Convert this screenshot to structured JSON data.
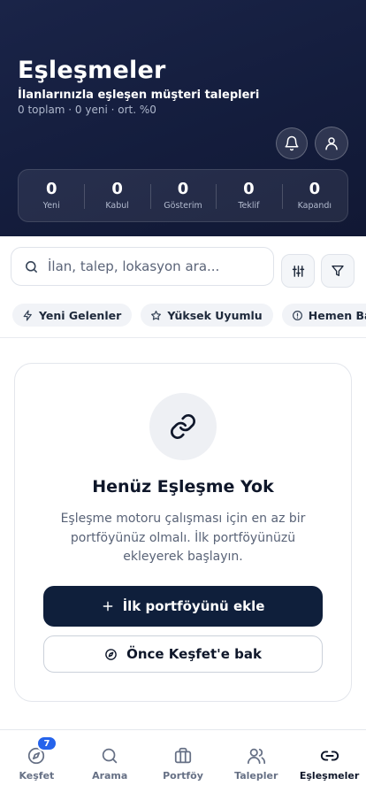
{
  "header": {
    "title": "Eşleşmeler",
    "subtitle": "İlanlarınızla eşleşen müşteri talepleri",
    "meta": "0 toplam · 0 yeni · ort. %0"
  },
  "stats": [
    {
      "value": "0",
      "label": "Yeni"
    },
    {
      "value": "0",
      "label": "Kabul"
    },
    {
      "value": "0",
      "label": "Gösterim"
    },
    {
      "value": "0",
      "label": "Teklif"
    },
    {
      "value": "0",
      "label": "Kapandı"
    }
  ],
  "search": {
    "placeholder": "İlan, talep, lokasyon ara...",
    "value": ""
  },
  "chips": [
    {
      "label": "Yeni Gelenler",
      "icon": "zap-icon"
    },
    {
      "label": "Yüksek Uyumlu",
      "icon": "star-icon"
    },
    {
      "label": "Hemen Bak",
      "icon": "alert-circle-icon"
    }
  ],
  "empty_state": {
    "icon": "link-icon",
    "title": "Henüz Eşleşme Yok",
    "description": "Eşleşme motoru çalışması için en az bir portföyünüz olmalı. İlk portföyünüzü ekleyerek başlayın.",
    "primary_label": "İlk portföyünü ekle",
    "secondary_label": "Önce Keşfet'e bak"
  },
  "tabs": [
    {
      "label": "Keşfet",
      "icon": "compass-icon",
      "badge": "7"
    },
    {
      "label": "Arama",
      "icon": "search-icon"
    },
    {
      "label": "Portföy",
      "icon": "briefcase-icon"
    },
    {
      "label": "Talepler",
      "icon": "users-icon"
    },
    {
      "label": "Eşleşmeler",
      "icon": "link-icon",
      "active": true
    }
  ],
  "colors": {
    "header_bg": "#151e3f",
    "primary": "#0f1f3b",
    "badge": "#2563eb"
  }
}
